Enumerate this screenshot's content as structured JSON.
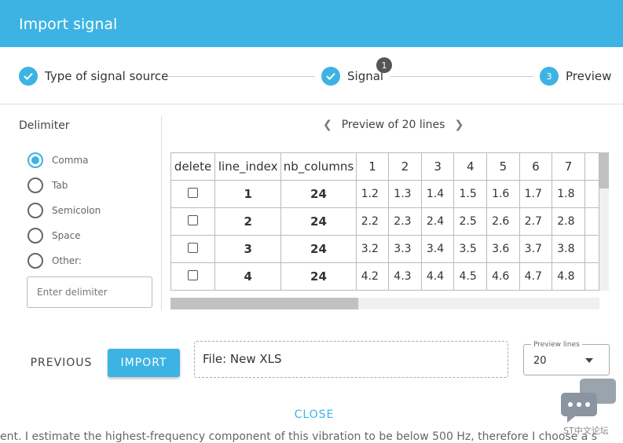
{
  "dialog": {
    "title": "Import signal"
  },
  "stepper": {
    "steps": [
      {
        "label": "Type of signal source",
        "status": "done"
      },
      {
        "label": "Signal",
        "status": "done",
        "badge": "1"
      },
      {
        "label": "Preview",
        "status": "active",
        "number": "3"
      }
    ],
    "accent_color": "#3db3e3"
  },
  "delimiter": {
    "label": "Delimiter",
    "options": [
      {
        "label": "Comma",
        "selected": true
      },
      {
        "label": "Tab",
        "selected": false
      },
      {
        "label": "Semicolon",
        "selected": false
      },
      {
        "label": "Space",
        "selected": false
      },
      {
        "label": "Other:",
        "selected": false
      }
    ],
    "input_placeholder": "Enter delimiter"
  },
  "preview": {
    "title": "Preview of 20 lines",
    "table": {
      "headers": [
        "delete",
        "line_index",
        "nb_columns",
        "1",
        "2",
        "3",
        "4",
        "5",
        "6",
        "7"
      ],
      "rows": [
        {
          "line_index": "1",
          "nb_columns": "24",
          "values": [
            "1.2",
            "1.3",
            "1.4",
            "1.5",
            "1.6",
            "1.7",
            "1.8"
          ]
        },
        {
          "line_index": "2",
          "nb_columns": "24",
          "values": [
            "2.2",
            "2.3",
            "2.4",
            "2.5",
            "2.6",
            "2.7",
            "2.8"
          ]
        },
        {
          "line_index": "3",
          "nb_columns": "24",
          "values": [
            "3.2",
            "3.3",
            "3.4",
            "3.5",
            "3.6",
            "3.7",
            "3.8"
          ]
        },
        {
          "line_index": "4",
          "nb_columns": "24",
          "values": [
            "4.2",
            "4.3",
            "4.4",
            "4.5",
            "4.6",
            "4.7",
            "4.8"
          ]
        }
      ]
    }
  },
  "actions": {
    "previous_label": "PREVIOUS",
    "import_label": "IMPORT",
    "file_label": "File: New XLS",
    "preview_lines": {
      "label": "Preview lines",
      "value": "20"
    }
  },
  "footer": {
    "close_label": "CLOSE"
  },
  "background_text": "ent. I estimate the highest-frequency component of this vibration to be below 500 Hz, therefore I choose a s",
  "watermark": {
    "text": "ST中文论坛"
  }
}
